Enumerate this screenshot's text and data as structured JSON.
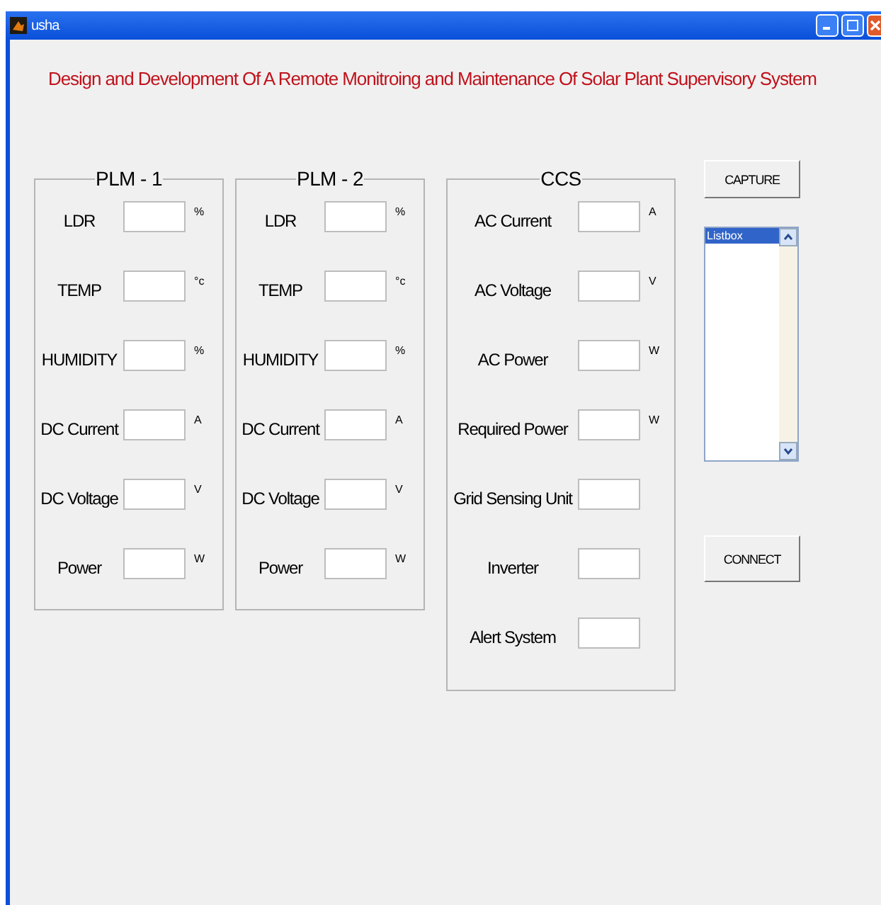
{
  "window": {
    "title": "usha"
  },
  "heading": "Design and Development Of A Remote Monitroing and Maintenance Of Solar Plant Supervisory System",
  "panels": [
    {
      "title": "PLM - 1",
      "rows": [
        {
          "label": "LDR",
          "unit": "%"
        },
        {
          "label": "TEMP",
          "unit": "°c"
        },
        {
          "label": "HUMIDITY",
          "unit": "%"
        },
        {
          "label": "DC Current",
          "unit": "A"
        },
        {
          "label": "DC Voltage",
          "unit": "V"
        },
        {
          "label": "Power",
          "unit": "W"
        }
      ]
    },
    {
      "title": "PLM - 2",
      "rows": [
        {
          "label": "LDR",
          "unit": "%"
        },
        {
          "label": "TEMP",
          "unit": "°c"
        },
        {
          "label": "HUMIDITY",
          "unit": "%"
        },
        {
          "label": "DC Current",
          "unit": "A"
        },
        {
          "label": "DC Voltage",
          "unit": "V"
        },
        {
          "label": "Power",
          "unit": "W"
        }
      ]
    },
    {
      "title": "CCS",
      "rows": [
        {
          "label": "AC Current",
          "unit": "A"
        },
        {
          "label": "AC Voltage",
          "unit": "V"
        },
        {
          "label": "AC Power",
          "unit": "W"
        },
        {
          "label": "Required Power",
          "unit": "W"
        },
        {
          "label": "Grid Sensing Unit"
        },
        {
          "label": "Inverter"
        },
        {
          "label": "Alert System"
        }
      ]
    }
  ],
  "capture_button": "CAPTURE",
  "listbox": {
    "items": [
      {
        "text": "Listbox",
        "selected": true
      }
    ]
  },
  "connect_button": "CONNECT"
}
